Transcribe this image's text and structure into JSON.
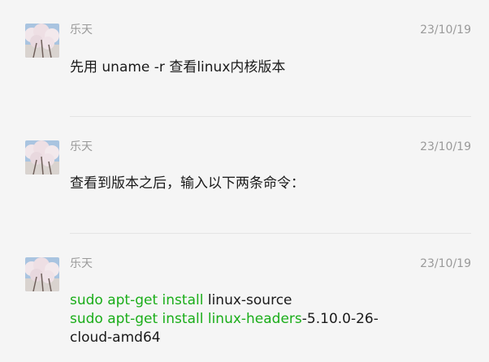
{
  "messages": [
    {
      "sender": "乐天",
      "time": "23/10/19",
      "text": "先用 uname -r 查看linux内核版本"
    },
    {
      "sender": "乐天",
      "time": "23/10/19",
      "text": "查看到版本之后，输入以下两条命令："
    },
    {
      "sender": "乐天",
      "time": "23/10/19",
      "line1_cmd": "sudo apt-get install",
      "line1_rest": " linux-source",
      "line2_cmd": "sudo apt-get install linux-headers",
      "line2_rest": "-5.10.0-26-",
      "line3": "cloud-amd64"
    }
  ],
  "colors": {
    "background": "#f5f5f5",
    "command_green": "#1aad19",
    "meta_gray": "#9a9a9a",
    "text": "#1a1a1a"
  },
  "icons": {
    "avatar": "cherry-blossom-tree-avatar-icon"
  }
}
